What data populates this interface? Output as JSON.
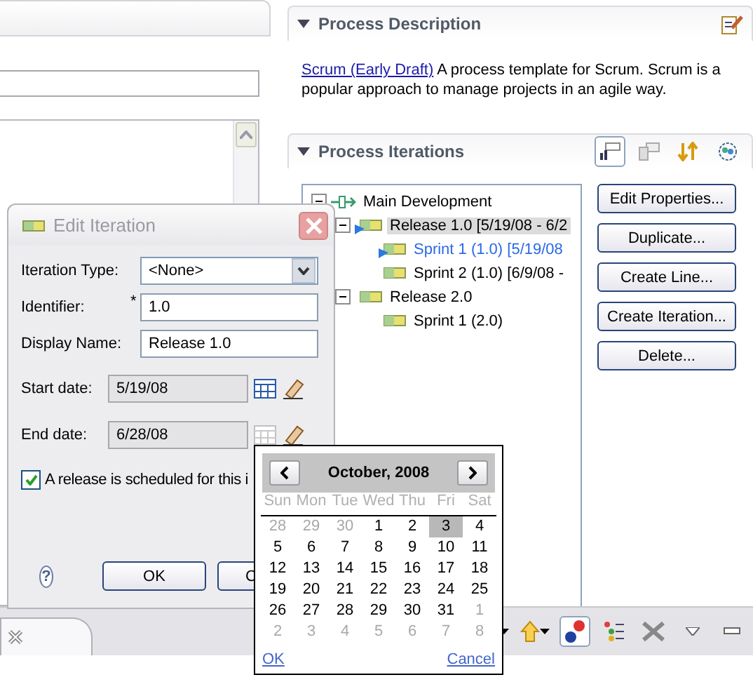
{
  "process_description": {
    "title": "Process Description",
    "link": "Scrum (Early Draft)",
    "text": "A process template for Scrum. Scrum is a popular approach to manage projects in an agile way."
  },
  "process_iterations": {
    "title": "Process Iterations",
    "toolbar": [
      {
        "kind": "layout",
        "pressed": true
      },
      {
        "kind": "details",
        "pressed": false
      },
      {
        "kind": "swap",
        "pressed": false
      },
      {
        "kind": "team",
        "pressed": false
      }
    ],
    "tree": [
      {
        "label": "Main Development",
        "kind": "line",
        "expanded": true,
        "selected": false,
        "active": false,
        "children": [
          {
            "label": "Release 1.0 [5/19/08 - 6/2",
            "kind": "iteration",
            "expanded": true,
            "selected": true,
            "current": true,
            "active": false,
            "children": [
              {
                "label": "Sprint 1 (1.0) [5/19/08",
                "kind": "iteration",
                "selected": false,
                "current": true,
                "active": true
              },
              {
                "label": "Sprint 2 (1.0) [6/9/08 -",
                "kind": "iteration",
                "selected": false,
                "current": false,
                "active": false
              }
            ]
          },
          {
            "label": "Release 2.0",
            "kind": "iteration",
            "expanded": true,
            "selected": false,
            "current": false,
            "active": false,
            "children": [
              {
                "label": "Sprint 1 (2.0)",
                "kind": "iteration",
                "selected": false,
                "current": false,
                "active": false
              }
            ]
          }
        ]
      }
    ],
    "buttons": [
      "Edit Properties...",
      "Duplicate...",
      "Create Line...",
      "Create Iteration...",
      "Delete..."
    ]
  },
  "bottom_toolbar": [
    {
      "kind": "down",
      "pressed": false
    },
    {
      "kind": "up",
      "pressed": false
    },
    {
      "kind": "errors",
      "pressed": true
    },
    {
      "kind": "tree",
      "pressed": false
    },
    {
      "kind": "tools",
      "pressed": false
    },
    {
      "kind": "menu",
      "pressed": false
    },
    {
      "kind": "minimize",
      "pressed": false
    }
  ],
  "dialog": {
    "title": "Edit Iteration",
    "fields": [
      {
        "kind": "combo",
        "label": "Iteration Type:",
        "value": "<None>"
      },
      {
        "kind": "text",
        "label": "Identifier:",
        "value": "1.0",
        "required_mark": "*"
      },
      {
        "kind": "text",
        "label": "Display Name:",
        "value": "Release 1.0"
      },
      {
        "kind": "date",
        "label": "Start date:",
        "value": "5/19/08",
        "disabled": true,
        "picker_enabled": true
      },
      {
        "kind": "date",
        "label": "End date:",
        "value": "6/28/08",
        "disabled": true,
        "picker_enabled": false
      }
    ],
    "checkbox": {
      "label": "A release is scheduled for this i",
      "checked": true
    },
    "help": "?",
    "buttons": [
      "OK",
      "C"
    ]
  },
  "calendar": {
    "title": "October, 2008",
    "weekdays": [
      "Sun",
      "Mon",
      "Tue",
      "Wed",
      "Thu",
      "Fri",
      "Sat"
    ],
    "days": [
      {
        "label": "28",
        "in_month": false,
        "selected": false
      },
      {
        "label": "29",
        "in_month": false,
        "selected": false
      },
      {
        "label": "30",
        "in_month": false,
        "selected": false
      },
      {
        "label": "1",
        "in_month": true,
        "selected": false
      },
      {
        "label": "2",
        "in_month": true,
        "selected": false
      },
      {
        "label": "3",
        "in_month": true,
        "selected": true
      },
      {
        "label": "4",
        "in_month": true,
        "selected": false
      },
      {
        "label": "5",
        "in_month": true,
        "selected": false
      },
      {
        "label": "6",
        "in_month": true,
        "selected": false
      },
      {
        "label": "7",
        "in_month": true,
        "selected": false
      },
      {
        "label": "8",
        "in_month": true,
        "selected": false
      },
      {
        "label": "9",
        "in_month": true,
        "selected": false
      },
      {
        "label": "10",
        "in_month": true,
        "selected": false
      },
      {
        "label": "11",
        "in_month": true,
        "selected": false
      },
      {
        "label": "12",
        "in_month": true,
        "selected": false
      },
      {
        "label": "13",
        "in_month": true,
        "selected": false
      },
      {
        "label": "14",
        "in_month": true,
        "selected": false
      },
      {
        "label": "15",
        "in_month": true,
        "selected": false
      },
      {
        "label": "16",
        "in_month": true,
        "selected": false
      },
      {
        "label": "17",
        "in_month": true,
        "selected": false
      },
      {
        "label": "18",
        "in_month": true,
        "selected": false
      },
      {
        "label": "19",
        "in_month": true,
        "selected": false
      },
      {
        "label": "20",
        "in_month": true,
        "selected": false
      },
      {
        "label": "21",
        "in_month": true,
        "selected": false
      },
      {
        "label": "22",
        "in_month": true,
        "selected": false
      },
      {
        "label": "23",
        "in_month": true,
        "selected": false
      },
      {
        "label": "24",
        "in_month": true,
        "selected": false
      },
      {
        "label": "25",
        "in_month": true,
        "selected": false
      },
      {
        "label": "26",
        "in_month": true,
        "selected": false
      },
      {
        "label": "27",
        "in_month": true,
        "selected": false
      },
      {
        "label": "28",
        "in_month": true,
        "selected": false
      },
      {
        "label": "29",
        "in_month": true,
        "selected": false
      },
      {
        "label": "30",
        "in_month": true,
        "selected": false
      },
      {
        "label": "31",
        "in_month": true,
        "selected": false
      },
      {
        "label": "1",
        "in_month": false,
        "selected": false
      },
      {
        "label": "2",
        "in_month": false,
        "selected": false
      },
      {
        "label": "3",
        "in_month": false,
        "selected": false
      },
      {
        "label": "4",
        "in_month": false,
        "selected": false
      },
      {
        "label": "5",
        "in_month": false,
        "selected": false
      },
      {
        "label": "6",
        "in_month": false,
        "selected": false
      },
      {
        "label": "7",
        "in_month": false,
        "selected": false
      },
      {
        "label": "8",
        "in_month": false,
        "selected": false
      }
    ],
    "links": [
      "OK",
      "Cancel"
    ]
  }
}
